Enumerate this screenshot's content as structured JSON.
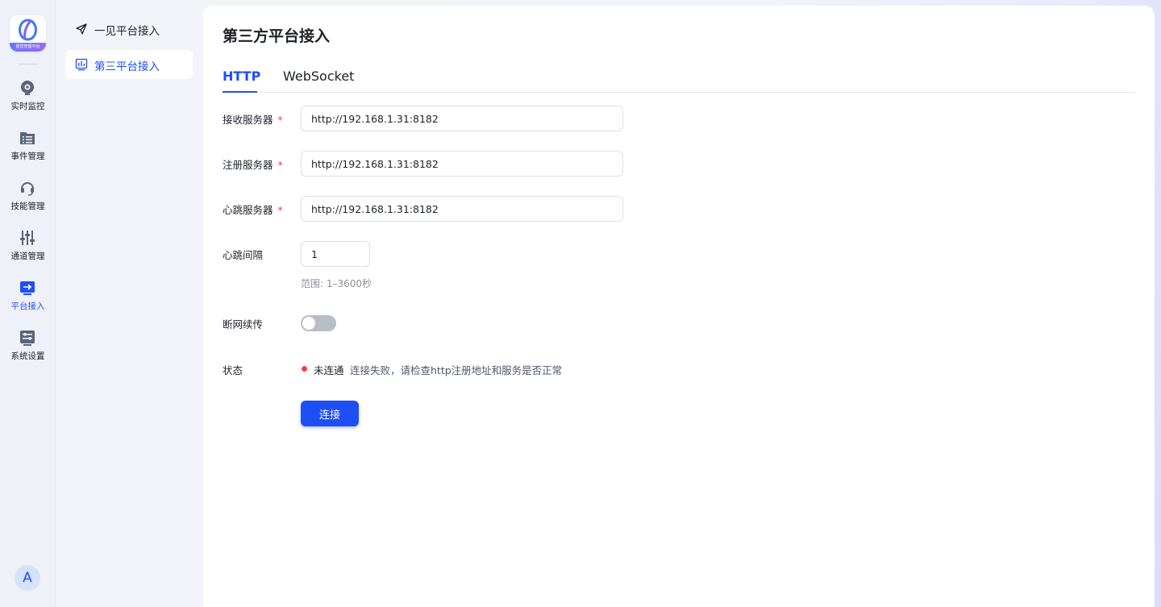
{
  "app": {
    "logo_text": "视觉管理平台",
    "avatar_initial": "A"
  },
  "rail": {
    "items": [
      {
        "label": "实时监控",
        "icon": "monitor-icon"
      },
      {
        "label": "事件管理",
        "icon": "folder-list-icon"
      },
      {
        "label": "技能管理",
        "icon": "headset-icon"
      },
      {
        "label": "通道管理",
        "icon": "sliders-icon"
      },
      {
        "label": "平台接入",
        "icon": "platform-access-icon"
      },
      {
        "label": "系统设置",
        "icon": "settings-panel-icon"
      }
    ],
    "active": "平台接入"
  },
  "submenu": {
    "items": [
      {
        "label": "一见平台接入",
        "icon": "send-icon"
      },
      {
        "label": "第三平台接入",
        "icon": "chart-board-icon"
      }
    ],
    "active": "第三平台接入"
  },
  "page": {
    "title": "第三方平台接入",
    "tabs": [
      "HTTP",
      "WebSocket"
    ],
    "active_tab": "HTTP"
  },
  "form": {
    "receive_server": {
      "label": "接收服务器",
      "value": "http://192.168.1.31:8182",
      "required": true
    },
    "register_server": {
      "label": "注册服务器",
      "value": "http://192.168.1.31:8182",
      "required": true
    },
    "heartbeat_server": {
      "label": "心跳服务器",
      "value": "http://192.168.1.31:8182",
      "required": true
    },
    "heartbeat_interval": {
      "label": "心跳间隔",
      "value": "1",
      "hint": "范围: 1–3600秒"
    },
    "resume_transfer": {
      "label": "断网续传",
      "enabled": false
    },
    "status": {
      "label": "状态",
      "value": "未连通",
      "message": "连接失败，请检查http注册地址和服务是否正常",
      "color": "#f53f3f"
    },
    "required_mark": "*",
    "connect_button": "连接"
  },
  "colors": {
    "accent": "#1d4ff5",
    "error": "#f53f3f"
  }
}
